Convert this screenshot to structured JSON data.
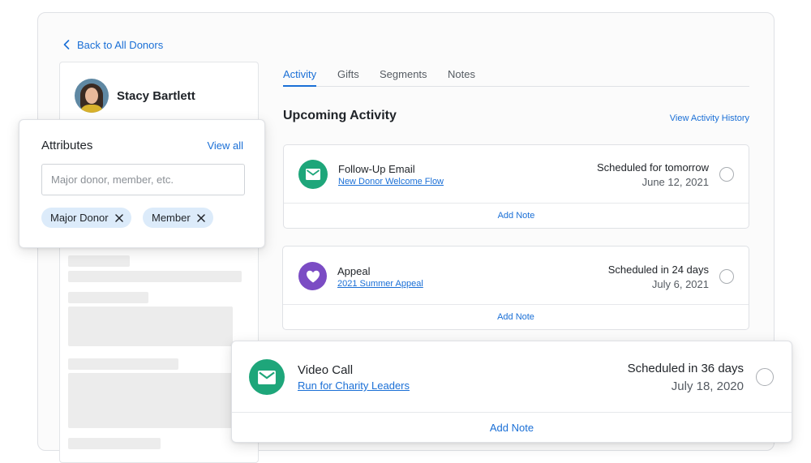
{
  "nav": {
    "back_label": "Back to All Donors"
  },
  "donor": {
    "name": "Stacy Bartlett"
  },
  "tabs": [
    {
      "label": "Activity",
      "active": true
    },
    {
      "label": "Gifts",
      "active": false
    },
    {
      "label": "Segments",
      "active": false
    },
    {
      "label": "Notes",
      "active": false
    }
  ],
  "upcoming": {
    "title": "Upcoming Activity",
    "history_link": "View Activity History",
    "items": [
      {
        "title": "Follow-Up Email",
        "link": "New Donor Welcome Flow",
        "when": "Scheduled for tomorrow",
        "date": "June 12, 2021",
        "icon": "mail-icon",
        "color": "#1ea67a",
        "action": "Add Note"
      },
      {
        "title": "Appeal",
        "link": "2021 Summer Appeal",
        "when": "Scheduled in 24 days",
        "date": "July 6, 2021",
        "icon": "heart-icon",
        "color": "#7b4cc4",
        "action": "Add Note"
      },
      {
        "title": "Video Call",
        "link": "Run for Charity Leaders",
        "when": "Scheduled in 36 days",
        "date": "July 18, 2020",
        "icon": "mail-icon",
        "color": "#1ea67a",
        "action": "Add Note"
      }
    ]
  },
  "attributes": {
    "title": "Attributes",
    "view_all": "View all",
    "placeholder": "Major donor, member, etc.",
    "tags": [
      "Major Donor",
      "Member"
    ]
  },
  "colors": {
    "accent": "#1a6fd6",
    "chip": "#dcebfa"
  }
}
